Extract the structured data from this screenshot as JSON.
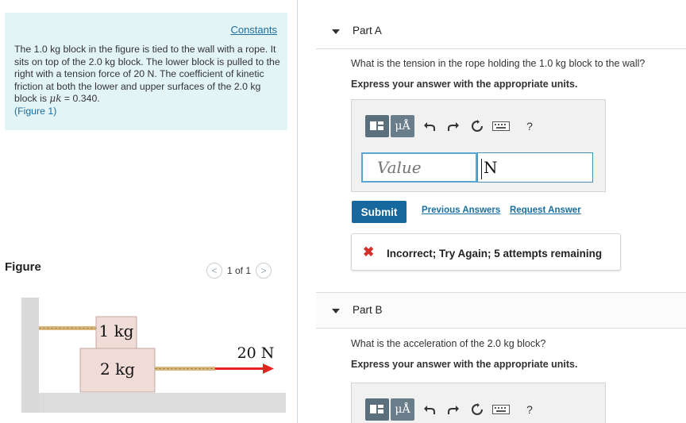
{
  "problem": {
    "constants_link": "Constants",
    "text_before_mu": "The 1.0 kg block in the figure is tied to the wall with a rope. It sits on top of the 2.0 kg block. The lower block is pulled to the right with a tension force of 20 N. The coefficient of kinetic friction at both the lower and upper surfaces of the 2.0 kg block is ",
    "mu_symbol": "μk",
    "text_after_mu": " = 0.340.",
    "figure_link": "(Figure 1)"
  },
  "figure_section": {
    "label": "Figure",
    "pager_text": "1 of 1",
    "prev_glyph": "<",
    "next_glyph": ">",
    "upper_block_label": "1 kg",
    "lower_block_label": "2 kg",
    "force_label": "20 N"
  },
  "part_a": {
    "title": "Part A",
    "question": "What is the tension in the rope holding the 1.0 kg block to the wall?",
    "instruction": "Express your answer with the appropriate units.",
    "toolbar": {
      "templates_icon": "templates-icon",
      "units_label": "μÅ",
      "undo_icon": "undo-icon",
      "redo_icon": "redo-icon",
      "reset_icon": "reset-icon",
      "keyboard_icon": "keyboard-icon",
      "help_label": "?"
    },
    "value_placeholder": "Value",
    "unit_value": "N",
    "submit_label": "Submit",
    "previous_answers_label": "Previous Answers",
    "request_answer_label": "Request Answer",
    "feedback": {
      "icon": "✖",
      "text": "Incorrect; Try Again; 5 attempts remaining"
    }
  },
  "part_b": {
    "title": "Part B",
    "question": "What is the acceleration of the 2.0 kg block?",
    "instruction": "Express your answer with the appropriate units.",
    "toolbar": {
      "units_label": "μÅ",
      "help_label": "?"
    }
  },
  "colors": {
    "problem_bg": "#e3f4f7",
    "link": "#1a6ea0",
    "submit_bg": "#16699e",
    "error": "#d4302b",
    "force_arrow": "#e8231f"
  }
}
